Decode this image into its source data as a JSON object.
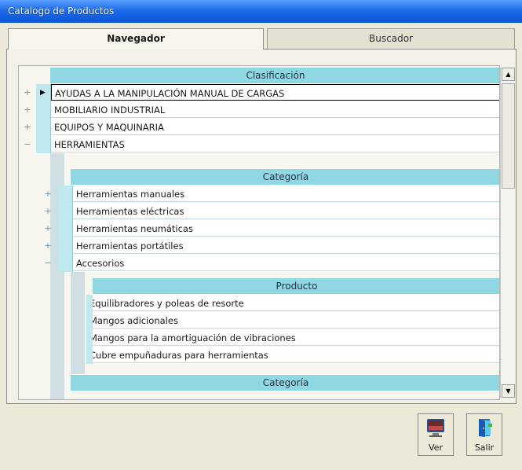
{
  "window": {
    "title": "Catalogo de Productos"
  },
  "tabs": {
    "active": "Navegador",
    "inactive": "Buscador"
  },
  "grid": {
    "header_level1": "Clasificación",
    "level1_items": [
      "AYUDAS A LA MANIPULACIÓN MANUAL DE CARGAS",
      "MOBILIARIO INDUSTRIAL",
      "EQUIPOS Y MAQUINARIA",
      "HERRAMIENTAS"
    ],
    "header_level2": "Categoría",
    "level2_items": [
      "Herramientas manuales",
      "Herramientas eléctricas",
      "Herramientas neumáticas",
      "Herramientas portátiles",
      "Accesorios"
    ],
    "header_level3": "Producto",
    "level3_items": [
      "Equilibradores y poleas de resorte",
      "Mangos adicionales",
      "Mangos para la amortiguación de vibraciones",
      "Cubre empuñaduras para herramientas"
    ],
    "header_level2_next": "Categoría",
    "expand_symbol": "+",
    "collapse_symbol": "−"
  },
  "buttons": {
    "view": "Ver",
    "exit": "Salir"
  },
  "scroll": {
    "up_arrow": "▲",
    "down_arrow": "▼"
  }
}
